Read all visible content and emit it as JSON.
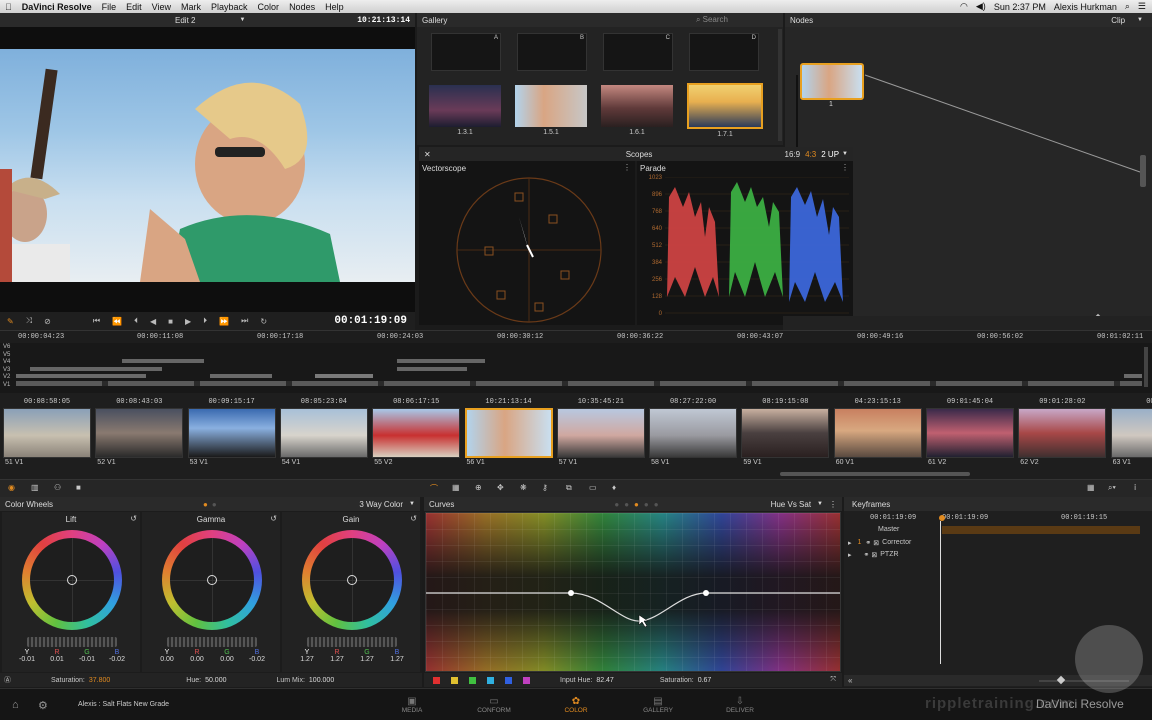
{
  "menubar": {
    "app": "DaVinci Resolve",
    "items": [
      "File",
      "Edit",
      "View",
      "Mark",
      "Playback",
      "Color",
      "Nodes",
      "Help"
    ],
    "clock": "Sun 2:37 PM",
    "user": "Alexis Hurkman"
  },
  "viewer": {
    "timeline_name": "Edit 2",
    "timecode_top": "10:21:13:14",
    "timecode_bottom": "00:01:19:09"
  },
  "gallery": {
    "title": "Gallery",
    "search_placeholder": "Search",
    "memories": [
      "A",
      "B",
      "C",
      "D"
    ],
    "stills": [
      "1.3.1",
      "1.5.1",
      "1.6.1",
      "1.7.1"
    ]
  },
  "nodes": {
    "title": "Nodes",
    "mode": "Clip",
    "node_label": "1"
  },
  "scopes": {
    "title": "Scopes",
    "ratio_a": "16:9",
    "ratio_b": "4:3",
    "layout": "2 UP",
    "vectorscope_title": "Vectorscope",
    "parade_title": "Parade",
    "parade_ticks": [
      "1023",
      "896",
      "768",
      "640",
      "512",
      "384",
      "256",
      "128",
      "0"
    ]
  },
  "timeline": {
    "ruler": [
      "00:00:04:23",
      "00:00:11:08",
      "00:00:17:18",
      "00:00:24:03",
      "00:00:30:12",
      "00:00:36:22",
      "00:00:43:07",
      "00:00:49:16",
      "00:00:56:02",
      "00:01:02:11"
    ],
    "tracks": [
      "V6",
      "V5",
      "V4",
      "V3",
      "V2",
      "V1"
    ]
  },
  "clips": [
    {
      "tc": "00:08:58:05",
      "label": "51 V1"
    },
    {
      "tc": "00:08:43:03",
      "label": "52 V1"
    },
    {
      "tc": "00:09:15:17",
      "label": "53 V1"
    },
    {
      "tc": "08:05:23:04",
      "label": "54 V1"
    },
    {
      "tc": "08:06:17:15",
      "label": "55 V2"
    },
    {
      "tc": "10:21:13:14",
      "label": "56 V1"
    },
    {
      "tc": "10:35:45:21",
      "label": "57 V1"
    },
    {
      "tc": "08:27:22:00",
      "label": "58 V1"
    },
    {
      "tc": "08:19:15:08",
      "label": "59 V1"
    },
    {
      "tc": "04:23:15:13",
      "label": "60 V1"
    },
    {
      "tc": "09:01:45:04",
      "label": "61 V2"
    },
    {
      "tc": "09:01:28:02",
      "label": "62 V2"
    },
    {
      "tc": "00:0",
      "label": "63 V1"
    }
  ],
  "colorwheels": {
    "title": "Color Wheels",
    "mode": "3 Way Color",
    "wheels": [
      {
        "name": "Lift",
        "y": "-0.01",
        "r": "0.01",
        "g": "-0.01",
        "b": "-0.02"
      },
      {
        "name": "Gamma",
        "y": "0.00",
        "r": "0.00",
        "g": "0.00",
        "b": "-0.02"
      },
      {
        "name": "Gain",
        "y": "1.27",
        "r": "1.27",
        "g": "1.27",
        "b": "1.27"
      }
    ],
    "channel_labels": [
      "Y",
      "R",
      "G",
      "B"
    ],
    "saturation_label": "Saturation:",
    "saturation_value": "37.800",
    "hue_label": "Hue:",
    "hue_value": "50.000",
    "lummix_label": "Lum Mix:",
    "lummix_value": "100.000"
  },
  "curves": {
    "title": "Curves",
    "mode": "Hue Vs Sat",
    "input_hue_label": "Input Hue:",
    "input_hue_value": "82.47",
    "saturation_label": "Saturation:",
    "saturation_value": "0.67"
  },
  "keyframes": {
    "title": "Keyframes",
    "tc_a": "00:01:19:09",
    "tc_b": "00:01:19:09",
    "tc_c": "00:01:19:15",
    "master": "Master",
    "rows": [
      {
        "num": "1",
        "label": "Corrector"
      },
      {
        "num": "",
        "label": "PTZR"
      }
    ]
  },
  "bottom": {
    "grade_name": "Alexis : Salt Flats New Grade",
    "tabs": [
      "MEDIA",
      "CONFORM",
      "COLOR",
      "GALLERY",
      "DELIVER"
    ],
    "active_tab": "COLOR",
    "brand": "rippletraining.com",
    "watermark": "DaVinci Resolve"
  }
}
